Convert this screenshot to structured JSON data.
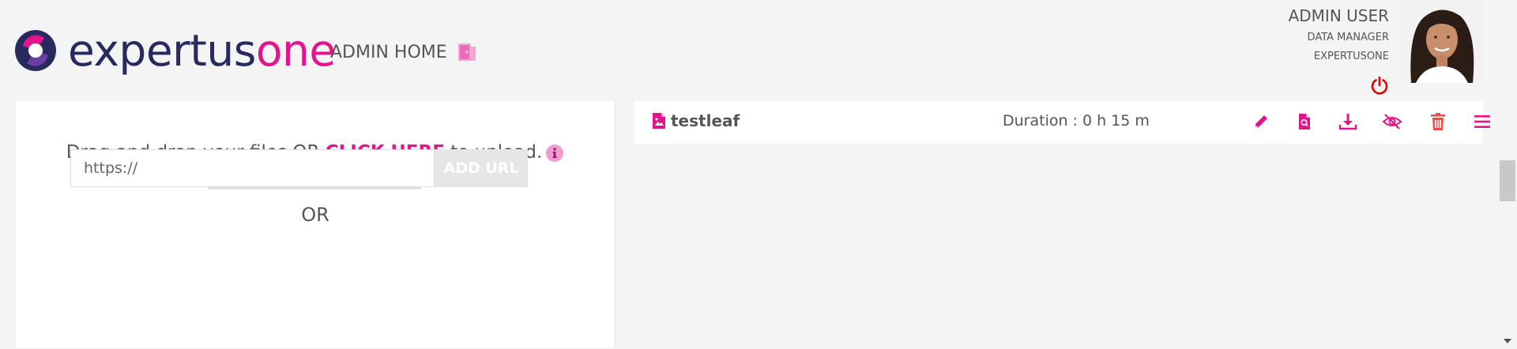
{
  "header": {
    "brand_part1": "expertus",
    "brand_part2": "one",
    "admin_home_label": "ADMIN HOME",
    "colors": {
      "brand_navy": "#262a5e",
      "brand_pink": "#e4148c",
      "power_red": "#e00000"
    }
  },
  "user": {
    "name": "ADMIN USER",
    "role": "DATA MANAGER",
    "organization": "EXPERTUSONE"
  },
  "upload": {
    "drop_text_before": "Drag and drop your files OR ",
    "click_here_label": "CLICK HERE",
    "drop_text_after": " to upload.",
    "progress_fraction": 0,
    "or_label": "OR",
    "url_placeholder": "https://",
    "url_value": "",
    "add_url_label": "ADD URL"
  },
  "content_item": {
    "name": "testleaf",
    "duration": "Duration : 0 h 15 m",
    "actions": [
      "edit-icon",
      "preview-icon",
      "download-icon",
      "hide-icon",
      "delete-icon",
      "menu-icon"
    ]
  }
}
